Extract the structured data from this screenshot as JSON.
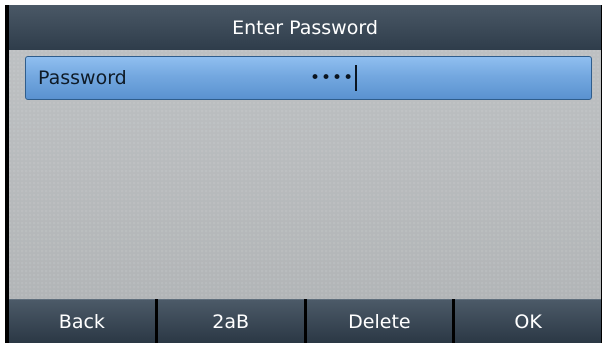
{
  "title": "Enter Password",
  "password_field": {
    "label": "Password",
    "masked_value": "••••"
  },
  "softkeys": [
    {
      "label": "Back"
    },
    {
      "label": "2aB"
    },
    {
      "label": "Delete"
    },
    {
      "label": "OK"
    }
  ],
  "colors": {
    "title_bar": "#3e4c5a",
    "field_highlight": "#74a8e0",
    "content_bg": "#b6b9bb",
    "softkey_bg": "#3a4855"
  }
}
